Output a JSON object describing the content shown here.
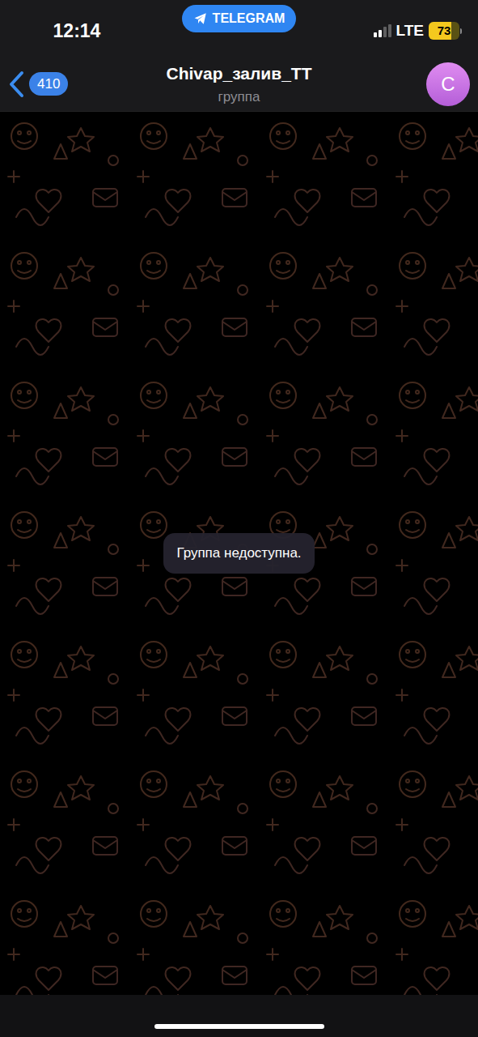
{
  "status_bar": {
    "time": "12:14",
    "app_pill": "TELEGRAM",
    "network": "LTE",
    "battery": "73",
    "battery_level": 0.73,
    "signal_level": 0.5
  },
  "nav": {
    "back_badge": "410",
    "title": "Chivap_залив_ТТ",
    "subtitle": "группа",
    "avatar_letter": "C"
  },
  "chat": {
    "service_message": "Группа недоступна."
  }
}
